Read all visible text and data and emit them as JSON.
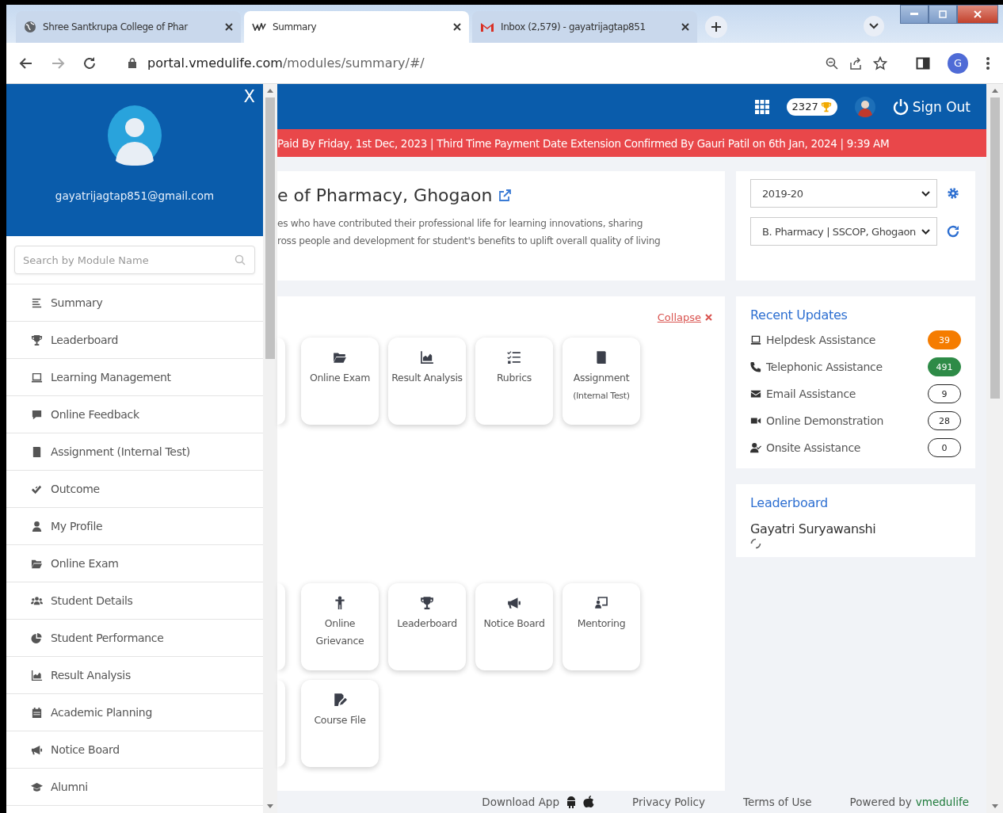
{
  "browser": {
    "tabs": [
      {
        "title": "Shree Santkrupa College of Phar",
        "selected": false
      },
      {
        "title": "Summary",
        "selected": true
      },
      {
        "title": "Inbox (2,579) - gayatrijagtap851",
        "selected": false
      }
    ],
    "url_host": "portal.vmedulife.com",
    "url_path": "/modules/summary/#/",
    "profile_initial": "G"
  },
  "sidebar": {
    "close": "X",
    "email": "gayatrijagtap851@gmail.com",
    "search": {
      "placeholder": "Search by Module Name"
    },
    "items": [
      {
        "label": "Summary"
      },
      {
        "label": "Leaderboard"
      },
      {
        "label": "Learning Management"
      },
      {
        "label": "Online Feedback"
      },
      {
        "label": "Assignment (Internal Test)"
      },
      {
        "label": "Outcome"
      },
      {
        "label": "My Profile"
      },
      {
        "label": "Online Exam"
      },
      {
        "label": "Student Details"
      },
      {
        "label": "Student Performance"
      },
      {
        "label": "Result Analysis"
      },
      {
        "label": "Academic Planning"
      },
      {
        "label": "Notice Board"
      },
      {
        "label": "Alumni"
      }
    ]
  },
  "topbar": {
    "points": "2327",
    "sign_out": "Sign Out"
  },
  "notice": "Paid By Friday, 1st Dec, 2023 | Third Time Payment Date Extension Confirmed By Gauri Patil on 6th Jan, 2024 | 9:39 AM",
  "college": {
    "title": "e of Pharmacy, Ghogaon",
    "description": [
      "es who have contributed their professional life for learning innovations, sharing",
      "ross people and development for student's benefits to uplift overall quality of living"
    ]
  },
  "filters": {
    "year": "2019-20",
    "program": "B. Pharmacy | SSCOP, Ghogaon"
  },
  "modules": {
    "collapse": "Collapse",
    "rows": [
      [
        {
          "label": "Online Exam"
        },
        {
          "label": "Result Analysis"
        },
        {
          "label": "Rubrics"
        },
        {
          "label": "Assignment",
          "sublabel": "(Internal Test)"
        }
      ],
      [
        {
          "label": "Online Grievance"
        },
        {
          "label": "Leaderboard"
        },
        {
          "label": "Notice Board"
        },
        {
          "label": "Mentoring"
        }
      ],
      [
        {
          "label": "Course File"
        }
      ]
    ]
  },
  "recent_updates": {
    "title": "Recent Updates",
    "items": [
      {
        "label": "Helpdesk Assistance",
        "count": "39",
        "color": "#f57c00"
      },
      {
        "label": "Telephonic Assistance",
        "count": "491",
        "color": "#2e8b47"
      },
      {
        "label": "Email Assistance",
        "count": "9"
      },
      {
        "label": "Online Demonstration",
        "count": "28"
      },
      {
        "label": "Onsite Assistance",
        "count": "0"
      }
    ]
  },
  "leaderboard": {
    "title": "Leaderboard",
    "name": "Gayatri Suryawanshi"
  },
  "footer": {
    "download": "Download App",
    "privacy": "Privacy Policy",
    "terms": "Terms of Use",
    "powered": "Powered by",
    "brand": "vmedulife"
  }
}
